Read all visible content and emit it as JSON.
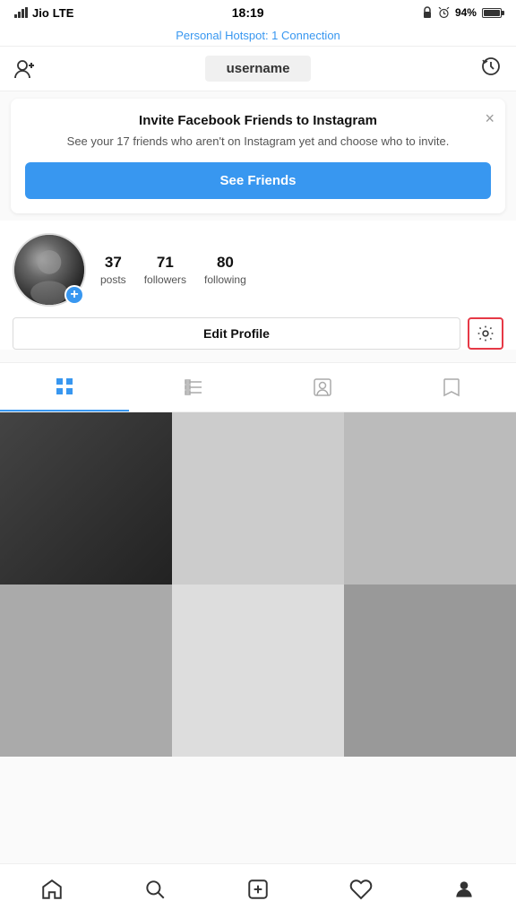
{
  "statusBar": {
    "carrier": "Jio",
    "network": "LTE",
    "time": "18:19",
    "battery": "94%",
    "hotspot": "Personal Hotspot: 1 Connection"
  },
  "topNav": {
    "username": "username",
    "addFriendLabel": "add friend",
    "historyLabel": "history"
  },
  "inviteBanner": {
    "title": "Invite Facebook Friends to Instagram",
    "description": "See your 17 friends who aren't on Instagram yet and choose who to invite.",
    "buttonLabel": "See Friends",
    "closeLabel": "×"
  },
  "profile": {
    "posts": {
      "count": "37",
      "label": "posts"
    },
    "followers": {
      "count": "71",
      "label": "followers"
    },
    "following": {
      "count": "80",
      "label": "following"
    },
    "editButton": "Edit Profile",
    "settingsLabel": "settings"
  },
  "tabs": [
    {
      "id": "grid",
      "label": "grid"
    },
    {
      "id": "list",
      "label": "list"
    },
    {
      "id": "tagged",
      "label": "tagged"
    },
    {
      "id": "saved",
      "label": "saved"
    }
  ],
  "bottomNav": {
    "home": "home",
    "search": "search",
    "add": "add post",
    "activity": "activity",
    "profile": "profile"
  }
}
